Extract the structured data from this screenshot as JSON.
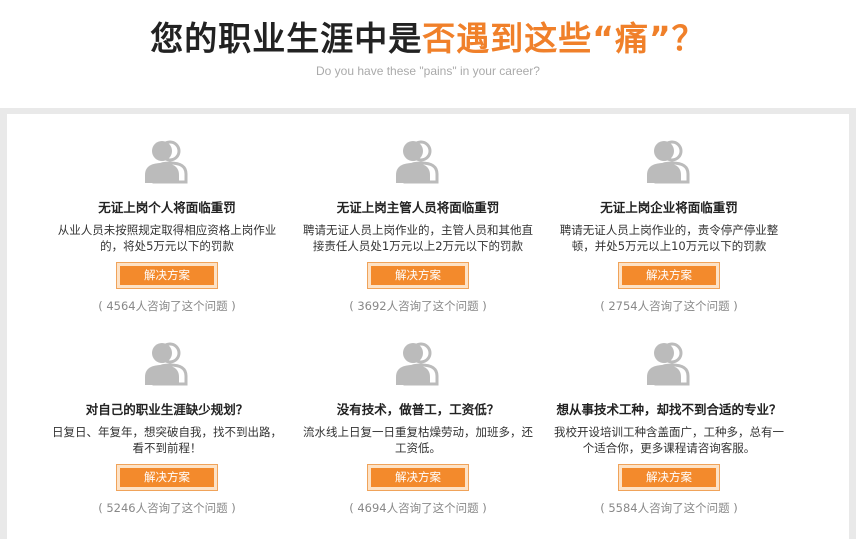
{
  "header": {
    "title_part1": "您的职业生涯中是",
    "title_part2": "否遇到这些“痛”？",
    "subtitle": "Do you have these \"pains\" in your career?",
    "accent_color": "#f0802a"
  },
  "cards": [
    {
      "icon": "user-group-icon",
      "title": "无证上岗个人将面临重罚",
      "desc": "从业人员未按照规定取得相应资格上岗作业的，将处5万元以下的罚款",
      "button": "解决方案",
      "asked": "( 4564人咨询了这个问题 )"
    },
    {
      "icon": "user-group-icon",
      "title": "无证上岗主管人员将面临重罚",
      "desc": "聘请无证人员上岗作业的，主管人员和其他直接责任人员处1万元以上2万元以下的罚款",
      "button": "解决方案",
      "asked": "( 3692人咨询了这个问题 )"
    },
    {
      "icon": "user-group-icon",
      "title": "无证上岗企业将面临重罚",
      "desc": "聘请无证人员上岗作业的，责令停产停业整顿，并处5万元以上10万元以下的罚款",
      "button": "解决方案",
      "asked": "( 2754人咨询了这个问题 )"
    },
    {
      "icon": "user-group-icon",
      "title": "对自己的职业生涯缺少规划？",
      "desc": "日复日、年复年，想突破自我，找不到出路，看不到前程！",
      "button": "解决方案",
      "asked": "( 5246人咨询了这个问题 )"
    },
    {
      "icon": "user-group-icon",
      "title": "没有技术，做普工，工资低？",
      "desc": "流水线上日复一日重复枯燥劳动，加班多，还工资低。",
      "button": "解决方案",
      "asked": "( 4694人咨询了这个问题 )"
    },
    {
      "icon": "user-group-icon",
      "title": "想从事技术工种，却找不到合适的专业？",
      "desc": "我校开设培训工种含盖面广，工种多，总有一个适合你，更多课程请咨询客服。",
      "button": "解决方案",
      "asked": "( 5584人咨询了这个问题 )"
    }
  ]
}
